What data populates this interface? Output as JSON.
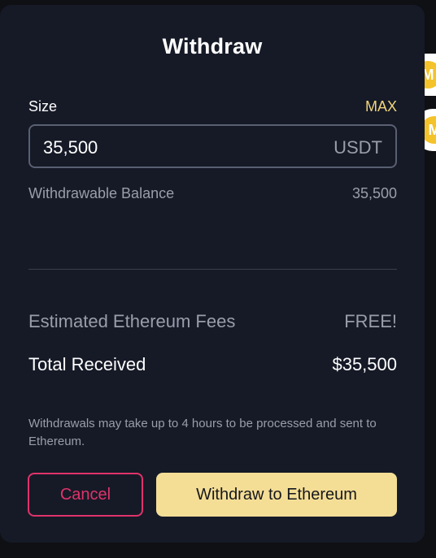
{
  "modal": {
    "title": "Withdraw",
    "size": {
      "label": "Size",
      "max_label": "MAX",
      "value": "35,500",
      "unit": "USDT"
    },
    "balance": {
      "label": "Withdrawable Balance",
      "value": "35,500"
    },
    "fees": {
      "label": "Estimated Ethereum Fees",
      "value": "FREE!"
    },
    "total": {
      "label": "Total Received",
      "value": "$35,500"
    },
    "notice": "Withdrawals may take up to 4 hours to be processed and sent to Ethereum.",
    "buttons": {
      "cancel": "Cancel",
      "withdraw": "Withdraw to Ethereum"
    }
  },
  "background_avatars": [
    {
      "letter": "M",
      "icon": "coin-avatar-icon"
    },
    {
      "letter": "M",
      "icon": "coin-avatar-icon"
    }
  ],
  "colors": {
    "modal_bg": "#161a27",
    "accent_gold": "#f0d47c",
    "withdraw_button": "#f4de96",
    "cancel_border": "#e0336a",
    "muted_text": "#9a9daa"
  }
}
